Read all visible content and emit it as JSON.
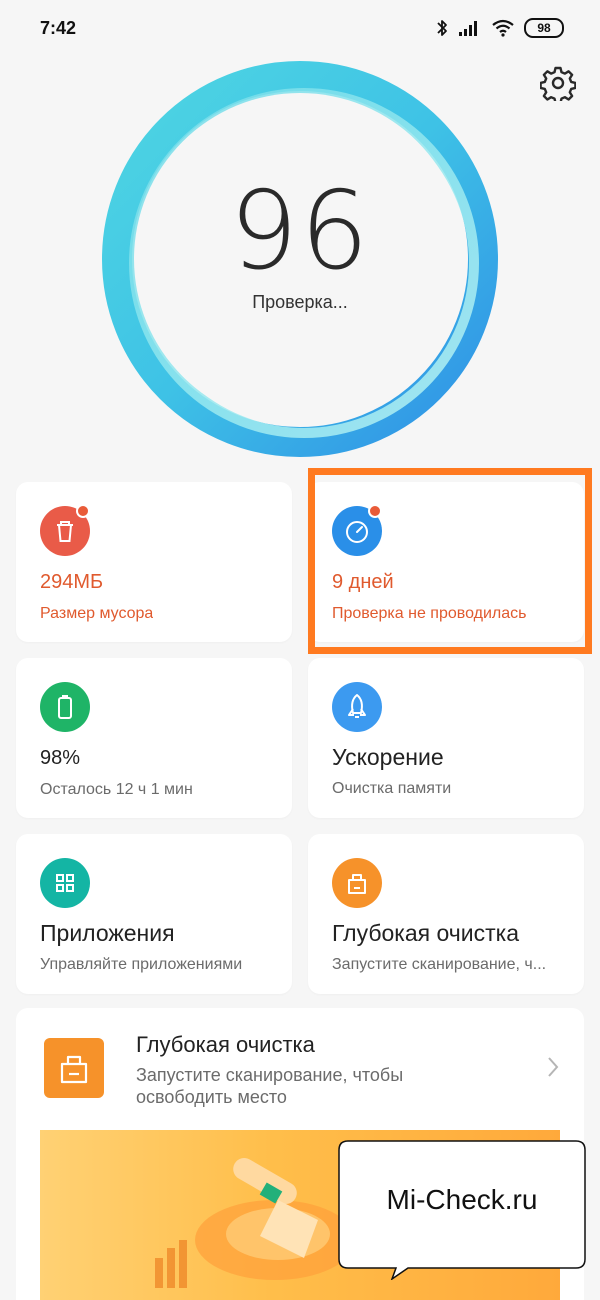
{
  "status_bar": {
    "time": "7:42",
    "battery": "98"
  },
  "score_ring": {
    "score": "96",
    "status": "Проверка..."
  },
  "cards": {
    "junk": {
      "value": "294МБ",
      "label": "Размер мусора"
    },
    "security": {
      "value": "9 дней",
      "label": "Проверка не проводилась"
    },
    "battery": {
      "value": "98%",
      "label": "Осталось 12 ч 1 мин"
    },
    "boost": {
      "title": "Ускорение",
      "label": "Очистка памяти"
    },
    "apps": {
      "title": "Приложения",
      "label": "Управляйте приложениями"
    },
    "deep_clean": {
      "title": "Глубокая очистка",
      "label": "Запустите сканирование, ч..."
    }
  },
  "deep_clean_card": {
    "title": "Глубокая очистка",
    "description": "Запустите сканирование, чтобы освободить место"
  },
  "watermark": {
    "text": "Mi-Check.ru"
  },
  "colors": {
    "warning": "#e05a2e",
    "highlight": "#ff7a20",
    "junk_icon": "#e95b48",
    "security_icon": "#2a8fe8",
    "battery_icon": "#1fb467",
    "boost_icon": "#3c9af0",
    "apps_icon": "#14b5a4",
    "deep_icon": "#f6922a"
  }
}
